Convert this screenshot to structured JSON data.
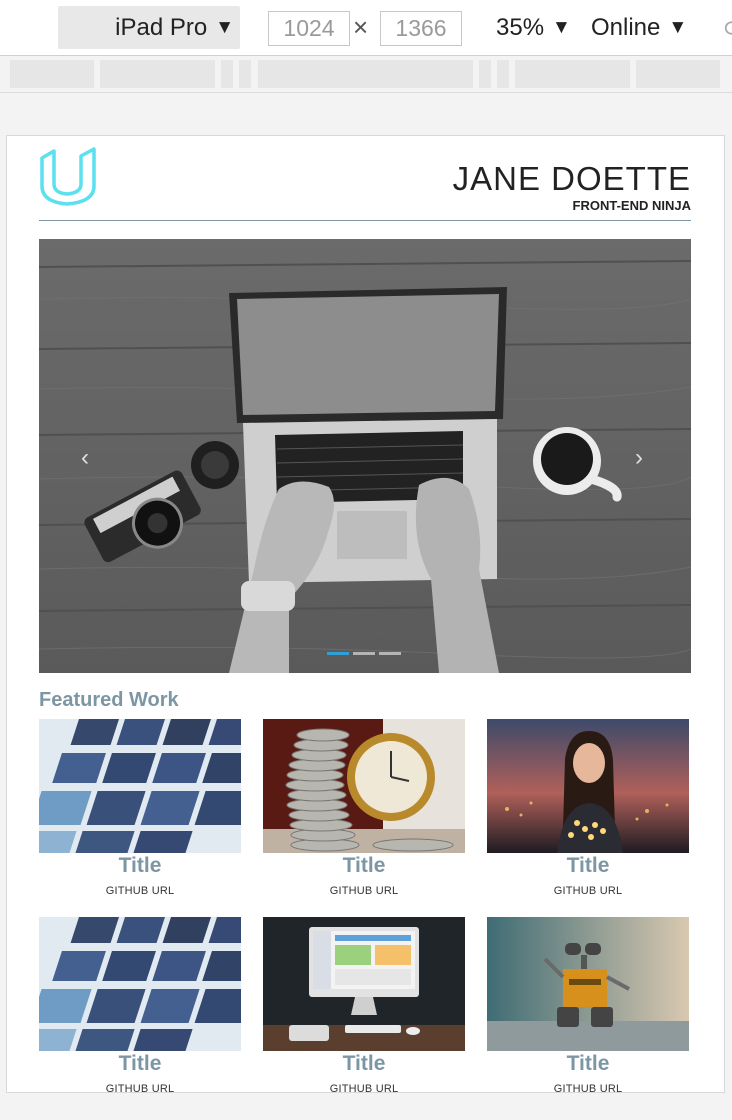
{
  "toolbar": {
    "device": "iPad Pro",
    "width": "1024",
    "height": "1366",
    "times": "×",
    "zoom": "35%",
    "network": "Online",
    "caret": "▼"
  },
  "header": {
    "name": "JANE DOETTE",
    "tagline": "FRONT-END NINJA"
  },
  "carousel": {
    "prev": "‹",
    "next": "›",
    "slide_count": 3,
    "active_index": 0
  },
  "featured": {
    "heading": "Featured Work",
    "items": [
      {
        "title": "Title",
        "url": "GITHUB URL",
        "image": "app-icons-screen"
      },
      {
        "title": "Title",
        "url": "GITHUB URL",
        "image": "coins-and-clock"
      },
      {
        "title": "Title",
        "url": "GITHUB URL",
        "image": "girl-with-lights"
      },
      {
        "title": "Title",
        "url": "GITHUB URL",
        "image": "app-icons-screen"
      },
      {
        "title": "Title",
        "url": "GITHUB URL",
        "image": "imac-desk"
      },
      {
        "title": "Title",
        "url": "GITHUB URL",
        "image": "wall-e-robot"
      }
    ]
  },
  "colors": {
    "accent": "#7d96a4",
    "logo": "#5ce0f0",
    "indicator_active": "#2f9fd6"
  }
}
